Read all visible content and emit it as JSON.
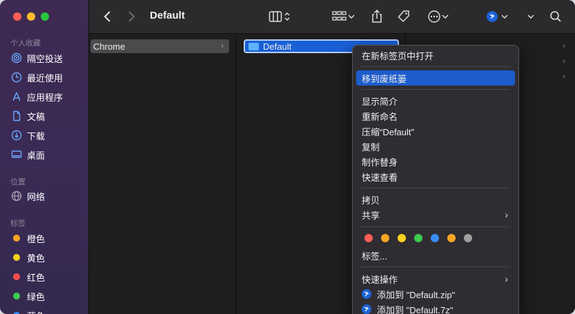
{
  "window": {
    "title": "Default"
  },
  "sidebar": {
    "favorites_header": "个人收藏",
    "favorites": [
      {
        "label": "隔空投送",
        "icon": "airdrop-icon"
      },
      {
        "label": "最近使用",
        "icon": "clock-icon"
      },
      {
        "label": "应用程序",
        "icon": "applications-icon"
      },
      {
        "label": "文稿",
        "icon": "document-icon"
      },
      {
        "label": "下载",
        "icon": "download-icon"
      },
      {
        "label": "桌面",
        "icon": "desktop-icon"
      }
    ],
    "locations_header": "位置",
    "locations": [
      {
        "label": "网络",
        "icon": "network-icon"
      }
    ],
    "tags_header": "标签",
    "tags": [
      {
        "label": "橙色",
        "color": "#f5a623"
      },
      {
        "label": "黄色",
        "color": "#f8d21c"
      },
      {
        "label": "红色",
        "color": "#fe4e4e"
      },
      {
        "label": "绿色",
        "color": "#3ecb4f"
      },
      {
        "label": "蓝色",
        "color": "#3a8cf7"
      }
    ]
  },
  "columns": {
    "col1": [
      {
        "label": "Chrome"
      }
    ],
    "col2": [
      {
        "label": "Default"
      }
    ]
  },
  "context_menu": {
    "open_new_tab": "在新标签页中打开",
    "move_to_trash": "移到废纸篓",
    "get_info": "显示简介",
    "rename": "重新命名",
    "compress": "压缩“Default”",
    "duplicate": "复制",
    "make_alias": "制作替身",
    "quick_look": "快速查看",
    "copy": "拷贝",
    "share": "共享",
    "tag_colors": [
      "#fe5f57",
      "#f5a623",
      "#f8d21c",
      "#3ecb4f",
      "#3a8cf7",
      "#f5a623",
      "#a0a0a0"
    ],
    "tags": "标签...",
    "quick_actions": "快速操作",
    "add_zip": "添加到 \"Default.zip\"",
    "add_7z": "添加到 \"Default.7z\""
  }
}
